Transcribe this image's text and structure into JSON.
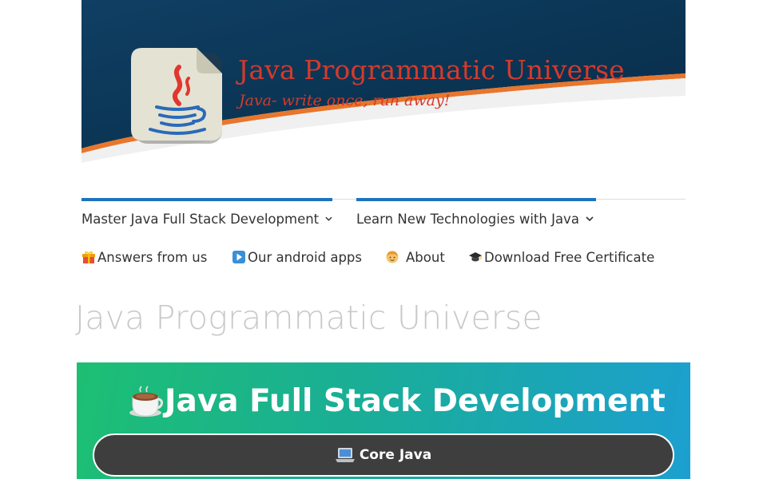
{
  "header": {
    "site_title": "Java Programmatic Universe",
    "tagline": "Java- write once, run away!",
    "logo_icon": "java-coffee-cup-icon",
    "colors": {
      "banner_dark": "#0d3a5c",
      "stripe": "#e8762c",
      "title_red": "#d43a2c"
    }
  },
  "nav": {
    "primary": [
      {
        "label": "Master Java Full Stack Development",
        "icon": "chevron-down-icon"
      },
      {
        "label": "Learn New Technologies with Java",
        "icon": "chevron-down-icon"
      }
    ],
    "secondary": [
      {
        "label": "Answers from us",
        "icon": "gift-icon"
      },
      {
        "label": "Our android apps",
        "icon": "play-button-icon"
      },
      {
        "label": "About",
        "icon": "person-icon"
      },
      {
        "label": "Download Free Certificate",
        "icon": "graduation-cap-icon"
      }
    ],
    "accent_color": "#1e73be"
  },
  "main": {
    "page_title": "Java Programmatic Universe",
    "hero": {
      "title": "Java Full Stack Development",
      "title_icon": "coffee-cup-icon",
      "button_label": "Core Java",
      "button_icon": "laptop-icon"
    }
  }
}
